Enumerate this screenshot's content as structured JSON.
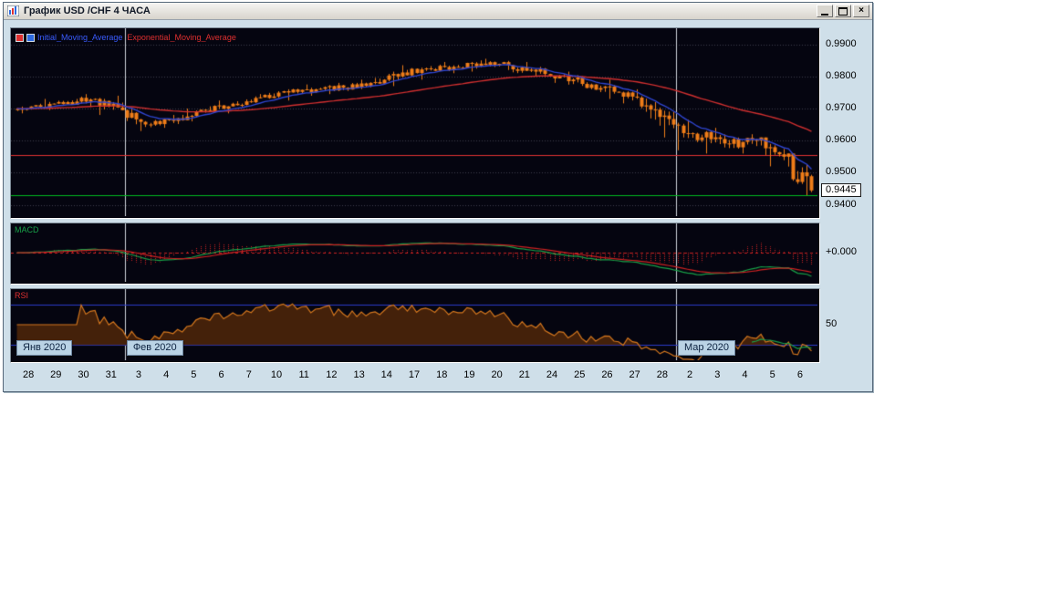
{
  "window": {
    "title": "График USD /CHF 4 ЧАСА",
    "buttons": {
      "close_glyph": "×"
    }
  },
  "legend": {
    "ma_label": "Initial_Moving_Average",
    "ema_label": "Exponential_Moving_Average"
  },
  "macd_panel": {
    "label": "MACD",
    "axis_label": "+0.000"
  },
  "rsi_panel": {
    "label": "RSI",
    "axis_label": "50"
  },
  "price_axis": {
    "ticks": [
      "0.9900",
      "0.9800",
      "0.9700",
      "0.9600",
      "0.9500",
      "0.9400"
    ],
    "current": "0.9445"
  },
  "months": [
    {
      "label": "Янв 2020",
      "day_index": 0
    },
    {
      "label": "Фев 2020",
      "day_index": 4
    },
    {
      "label": "Мар 2020",
      "day_index": 24
    }
  ],
  "chart_data": {
    "type": "candlestick",
    "symbol": "USD/CHF",
    "timeframe": "4 часа",
    "title": "График USD /CHF 4 ЧАСА",
    "candles_per_day": 6,
    "x_labels": [
      "28",
      "29",
      "30",
      "31",
      "3",
      "4",
      "5",
      "6",
      "7",
      "10",
      "11",
      "12",
      "13",
      "14",
      "17",
      "18",
      "19",
      "20",
      "21",
      "24",
      "25",
      "26",
      "27",
      "28",
      "2",
      "3",
      "4",
      "5",
      "6"
    ],
    "ohlc_daily": [
      [
        0.9695,
        0.9715,
        0.9685,
        0.9705
      ],
      [
        0.9705,
        0.973,
        0.9695,
        0.972
      ],
      [
        0.972,
        0.9745,
        0.9705,
        0.973
      ],
      [
        0.973,
        0.974,
        0.968,
        0.9695
      ],
      [
        0.9695,
        0.97,
        0.963,
        0.965
      ],
      [
        0.965,
        0.968,
        0.964,
        0.967
      ],
      [
        0.967,
        0.97,
        0.966,
        0.9695
      ],
      [
        0.9695,
        0.9725,
        0.9685,
        0.9715
      ],
      [
        0.9715,
        0.9745,
        0.9705,
        0.9735
      ],
      [
        0.9735,
        0.976,
        0.9725,
        0.975
      ],
      [
        0.975,
        0.9775,
        0.974,
        0.976
      ],
      [
        0.976,
        0.978,
        0.9745,
        0.9765
      ],
      [
        0.9765,
        0.979,
        0.9755,
        0.978
      ],
      [
        0.978,
        0.9815,
        0.977,
        0.98
      ],
      [
        0.98,
        0.9835,
        0.979,
        0.9825
      ],
      [
        0.9825,
        0.9845,
        0.981,
        0.983
      ],
      [
        0.983,
        0.985,
        0.9815,
        0.984
      ],
      [
        0.984,
        0.9855,
        0.982,
        0.9835
      ],
      [
        0.9835,
        0.9845,
        0.98,
        0.9815
      ],
      [
        0.9815,
        0.983,
        0.978,
        0.98
      ],
      [
        0.98,
        0.9815,
        0.976,
        0.9775
      ],
      [
        0.9775,
        0.979,
        0.973,
        0.975
      ],
      [
        0.975,
        0.976,
        0.969,
        0.971
      ],
      [
        0.971,
        0.972,
        0.961,
        0.965
      ],
      [
        0.965,
        0.9665,
        0.957,
        0.961
      ],
      [
        0.961,
        0.964,
        0.956,
        0.959
      ],
      [
        0.959,
        0.962,
        0.956,
        0.96
      ],
      [
        0.96,
        0.961,
        0.952,
        0.955
      ],
      [
        0.955,
        0.956,
        0.943,
        0.9445
      ]
    ],
    "ylim": [
      0.9365,
      0.995
    ],
    "y_ticks": [
      0.99,
      0.98,
      0.97,
      0.96,
      0.95,
      0.94
    ],
    "current_price": 0.9445,
    "hlines": [
      {
        "value": 0.9555,
        "color": "#e03232"
      },
      {
        "value": 0.943,
        "color": "#00b81f"
      }
    ],
    "overlays": [
      {
        "name": "Initial_Moving_Average",
        "period": 10,
        "color": "#2f45cf"
      },
      {
        "name": "Exponential_Moving_Average",
        "period": 55,
        "color": "#cf2f2f"
      }
    ],
    "indicators": [
      {
        "name": "MACD",
        "fast": 12,
        "slow": 26,
        "signal": 9,
        "zero_label": "+0.000",
        "colors": {
          "macd": "#18a048",
          "signal": "#cc2222",
          "histogram": "#cc2222"
        }
      },
      {
        "name": "RSI",
        "period": 14,
        "levels": [
          30,
          70
        ],
        "mid_label": "50",
        "colors": {
          "line": "#d4771e",
          "fill": "#44210a",
          "level": "#2b39c8",
          "tail": "#19a04b"
        }
      }
    ],
    "colors": {
      "panel_bg": "#050510",
      "grid": "#3f3f4c",
      "candle": "#ef7d18",
      "month_line": "#cdd3da"
    }
  }
}
